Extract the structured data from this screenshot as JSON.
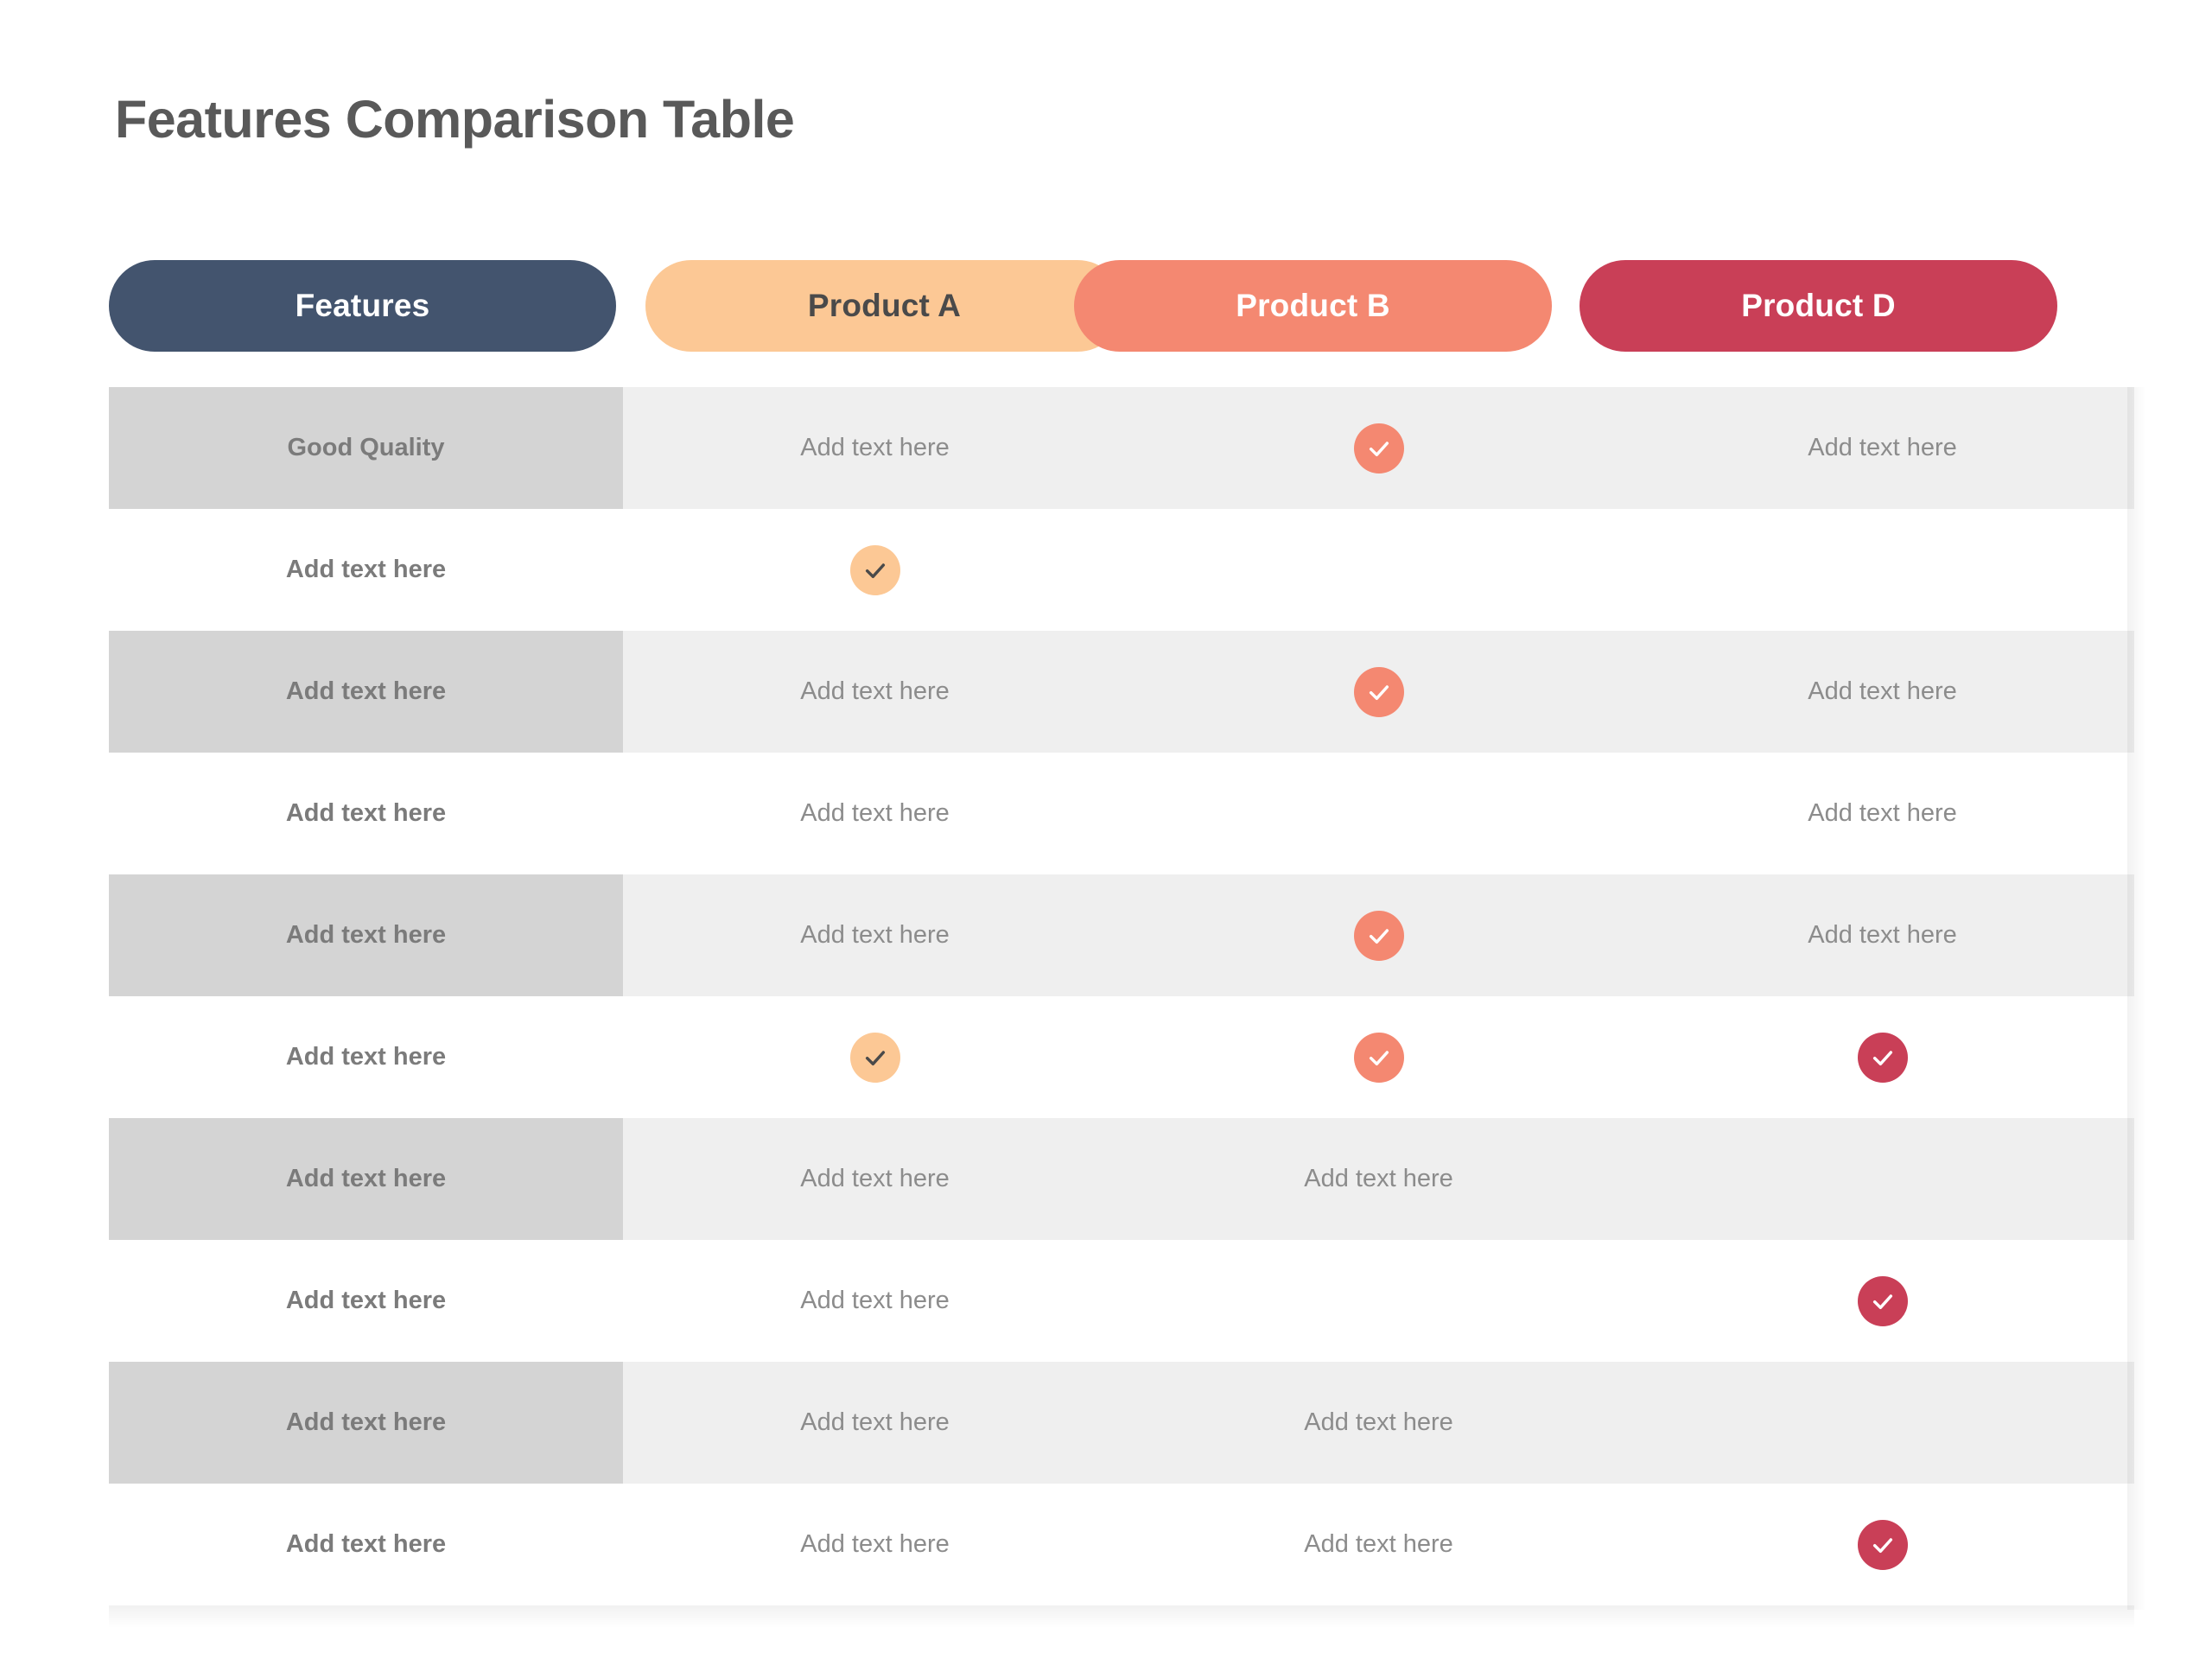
{
  "page": {
    "title": "Features Comparison Table"
  },
  "colors": {
    "features_pill": "#43546e",
    "product_a_pill": "#fcc895",
    "product_b_pill": "#f48871",
    "product_d_pill": "#c93f57",
    "row_shaded": "#efefef",
    "row_plain": "#ffffff",
    "feature_cell_shaded": "#d4d4d4",
    "title_text": "#595959",
    "feature_label_text": "#7b7b7b",
    "cell_text": "#8c8c8c",
    "check_a_bg": "#fcc895",
    "check_a_mark": "#4a4a4a",
    "check_b_bg": "#f48871",
    "check_b_mark": "#ffffff",
    "check_d_bg": "#c93f57",
    "check_d_mark": "#ffffff"
  },
  "header": {
    "columns": [
      {
        "label": "Features",
        "bg": "#43546e",
        "text_color": "#ffffff"
      },
      {
        "label": "Product A",
        "bg": "#fcc895",
        "text_color": "#4a4a4a"
      },
      {
        "label": "Product B",
        "bg": "#f48871",
        "text_color": "#ffffff"
      },
      {
        "label": "Product D",
        "bg": "#c93f57",
        "text_color": "#ffffff"
      }
    ]
  },
  "table": {
    "check_icon_name": "check-mark-icon",
    "rows": [
      {
        "shaded": true,
        "feature": "Good Quality",
        "cells": [
          {
            "type": "text",
            "value": "Add text here"
          },
          {
            "type": "check",
            "variant": "b"
          },
          {
            "type": "text",
            "value": "Add text here"
          }
        ]
      },
      {
        "shaded": false,
        "feature": "Add text here",
        "cells": [
          {
            "type": "check",
            "variant": "a"
          },
          {
            "type": "empty"
          },
          {
            "type": "empty"
          }
        ]
      },
      {
        "shaded": true,
        "feature": "Add text here",
        "cells": [
          {
            "type": "text",
            "value": "Add text here"
          },
          {
            "type": "check",
            "variant": "b"
          },
          {
            "type": "text",
            "value": "Add text here"
          }
        ]
      },
      {
        "shaded": false,
        "feature": "Add text here",
        "cells": [
          {
            "type": "text",
            "value": "Add text here"
          },
          {
            "type": "empty"
          },
          {
            "type": "text",
            "value": "Add text here"
          }
        ]
      },
      {
        "shaded": true,
        "feature": "Add text here",
        "cells": [
          {
            "type": "text",
            "value": "Add text here"
          },
          {
            "type": "check",
            "variant": "b"
          },
          {
            "type": "text",
            "value": "Add text here"
          }
        ]
      },
      {
        "shaded": false,
        "feature": "Add text here",
        "cells": [
          {
            "type": "check",
            "variant": "a"
          },
          {
            "type": "check",
            "variant": "b"
          },
          {
            "type": "check",
            "variant": "d"
          }
        ]
      },
      {
        "shaded": true,
        "feature": "Add text here",
        "cells": [
          {
            "type": "text",
            "value": "Add text here"
          },
          {
            "type": "text",
            "value": "Add text here"
          },
          {
            "type": "empty"
          }
        ]
      },
      {
        "shaded": false,
        "feature": "Add text here",
        "cells": [
          {
            "type": "text",
            "value": "Add text here"
          },
          {
            "type": "empty"
          },
          {
            "type": "check",
            "variant": "d"
          }
        ]
      },
      {
        "shaded": true,
        "feature": "Add text here",
        "cells": [
          {
            "type": "text",
            "value": "Add text here"
          },
          {
            "type": "text",
            "value": "Add text here"
          },
          {
            "type": "empty"
          }
        ]
      },
      {
        "shaded": false,
        "feature": "Add text here",
        "cells": [
          {
            "type": "text",
            "value": "Add text here"
          },
          {
            "type": "text",
            "value": "Add text here"
          },
          {
            "type": "check",
            "variant": "d"
          }
        ]
      }
    ]
  }
}
